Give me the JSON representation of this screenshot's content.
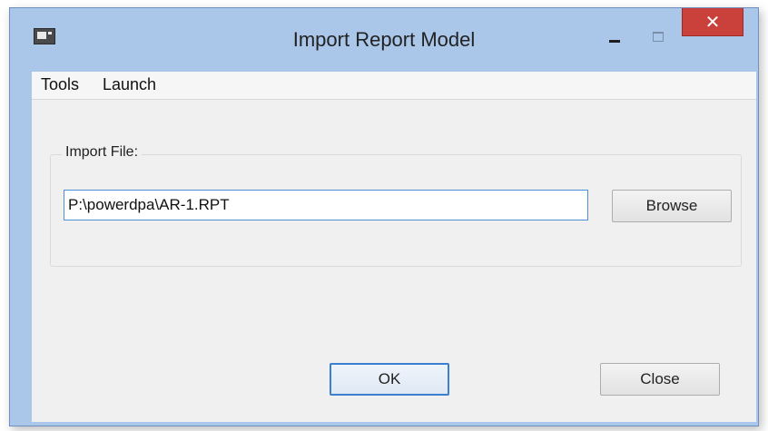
{
  "window": {
    "title": "Import Report Model",
    "controls": {
      "close_glyph": "✕"
    }
  },
  "menubar": {
    "items": [
      {
        "label": "Tools"
      },
      {
        "label": "Launch"
      }
    ]
  },
  "import_group": {
    "label": "Import File:",
    "file_path": "P:\\powerdpa\\AR-1.RPT",
    "browse_label": "Browse"
  },
  "footer": {
    "ok_label": "OK",
    "close_label": "Close"
  },
  "colors": {
    "accent": "#3c7fce",
    "close_button": "#c9413a",
    "frame": "#aac7ea"
  },
  "icons": {
    "app": "app-window-icon",
    "minimize": "minimize-icon",
    "maximize": "maximize-icon",
    "close": "close-icon"
  }
}
